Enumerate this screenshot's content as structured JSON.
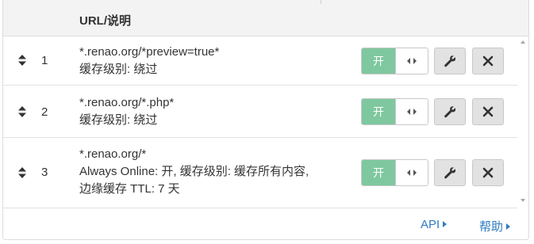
{
  "header": {
    "column_title": "URL/说明"
  },
  "rules": [
    {
      "index": "1",
      "url": "*.renao.org/*preview=true*",
      "desc_lines": [
        "缓存级别: 绕过"
      ],
      "toggle_label": "开"
    },
    {
      "index": "2",
      "url": "*.renao.org/*.php*",
      "desc_lines": [
        "缓存级别: 绕过"
      ],
      "toggle_label": "开"
    },
    {
      "index": "3",
      "url": "*.renao.org/*",
      "desc_lines": [
        "Always Online: 开, 缓存级别: 缓存所有内容,",
        "边缘缓存 TTL: 7 天"
      ],
      "toggle_label": "开"
    }
  ],
  "footer": {
    "api_link": "API",
    "help_link": "帮助"
  },
  "colors": {
    "toggle_on": "#7fc89f",
    "link": "#2f7bbf",
    "button_bg": "#e2e2e2",
    "header_bg": "#f3f3f3"
  },
  "icons": {
    "drag": "sort-arrows-icon",
    "toggle_handle": "code-arrows-icon",
    "edit": "wrench-icon",
    "delete": "close-icon"
  }
}
